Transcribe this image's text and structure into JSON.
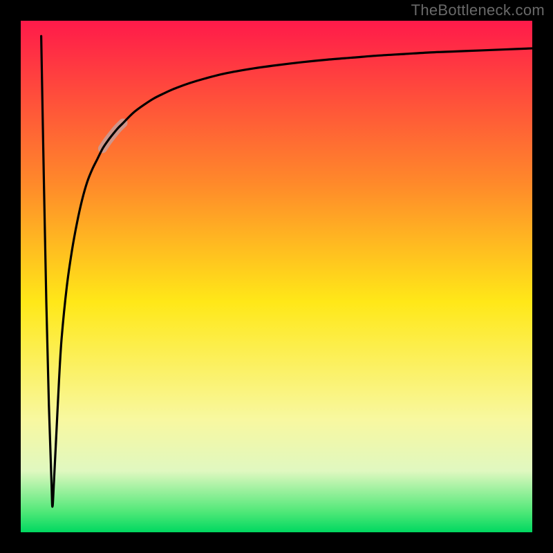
{
  "watermark": "TheBottleneck.com",
  "chart_data": {
    "type": "line",
    "title": "",
    "xlabel": "",
    "ylabel": "",
    "xlim": [
      0,
      100
    ],
    "ylim": [
      0,
      100
    ],
    "x": [
      4.0,
      4.5,
      5.0,
      5.5,
      6.0,
      6.2,
      6.5,
      7.0,
      7.5,
      8.0,
      9.0,
      10.0,
      11.0,
      12.0,
      13.0,
      14.0,
      15.0,
      16.0,
      17.0,
      18.0,
      19.0,
      20.0,
      22.0,
      24.0,
      26.0,
      28.0,
      30.0,
      33.0,
      36.0,
      40.0,
      45.0,
      50.0,
      55.0,
      60.0,
      65.0,
      70.0,
      75.0,
      80.0,
      85.0,
      90.0,
      95.0,
      100.0
    ],
    "y": [
      97.0,
      70.0,
      45.0,
      25.0,
      10.0,
      5.0,
      10.0,
      20.0,
      30.0,
      38.0,
      48.0,
      55.0,
      60.5,
      65.0,
      68.5,
      71.0,
      73.0,
      75.0,
      76.5,
      77.8,
      79.0,
      80.0,
      82.0,
      83.5,
      84.8,
      85.8,
      86.7,
      87.8,
      88.7,
      89.7,
      90.6,
      91.3,
      91.9,
      92.4,
      92.8,
      93.2,
      93.5,
      93.8,
      94.0,
      94.2,
      94.4,
      94.6
    ],
    "highlight_segment": {
      "x_start": 16.0,
      "x_end": 21.0
    },
    "border_thickness_px": 30,
    "background_gradient_stops": [
      {
        "offset": 0,
        "color": "#ff1a4a"
      },
      {
        "offset": 32,
        "color": "#ff8a2a"
      },
      {
        "offset": 55,
        "color": "#ffe818"
      },
      {
        "offset": 78,
        "color": "#f8f8a0"
      },
      {
        "offset": 88,
        "color": "#e0f8c0"
      },
      {
        "offset": 96,
        "color": "#50e878"
      },
      {
        "offset": 100,
        "color": "#00d860"
      }
    ],
    "highlight_color": "#c99a94",
    "curve_color": "#000000"
  }
}
